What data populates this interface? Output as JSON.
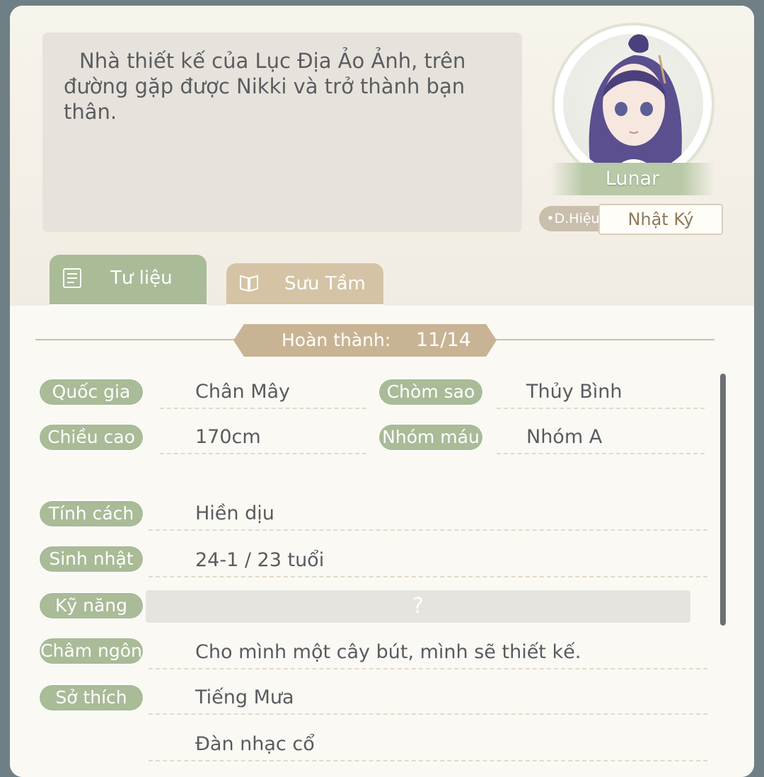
{
  "description": "Nhà thiết kế của Lục Địa Ảo Ảnh, trên đường gặp được Nikki và trở thành bạn thân.",
  "character": {
    "name": "Lunar",
    "tag_left": "•D.Hiệu",
    "tag_right": "Nhật Ký"
  },
  "tabs": [
    {
      "label": "Tư liệu",
      "icon": "document-icon",
      "active": true
    },
    {
      "label": "Sưu Tầm",
      "icon": "book-icon",
      "active": false
    }
  ],
  "progress": {
    "label": "Hoàn thành:",
    "value": "11/14"
  },
  "info": {
    "country": {
      "label": "Quốc gia",
      "value": "Chân Mây"
    },
    "constellation": {
      "label": "Chòm sao",
      "value": "Thủy Bình"
    },
    "height": {
      "label": "Chiều cao",
      "value": "170cm"
    },
    "blood": {
      "label": "Nhóm máu",
      "value": "Nhóm A"
    },
    "personality": {
      "label": "Tính cách",
      "value": "Hiền dịu"
    },
    "birthday": {
      "label": "Sinh nhật",
      "value": "24-1 / 23 tuổi"
    },
    "skill": {
      "label": "Kỹ năng",
      "value": "?"
    },
    "motto": {
      "label": "Châm ngôn",
      "value": "Cho mình một cây bút, mình sẽ thiết kế."
    },
    "hobby": {
      "label": "Sở thích",
      "value": "Tiếng Mưa",
      "value2": "Đàn nhạc cổ"
    }
  },
  "colors": {
    "label_green": "#a9bb97",
    "tab_tan": "#d4c4a5",
    "panel_bg": "#f8f5ee"
  }
}
